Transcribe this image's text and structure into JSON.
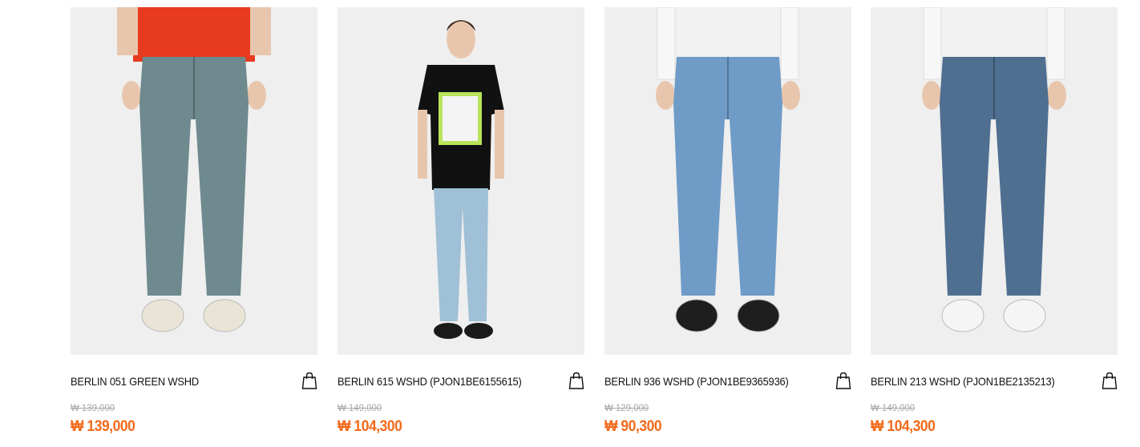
{
  "products": [
    {
      "name": "BERLIN 051 GREEN WSHD",
      "original_price": "₩ 139,000",
      "sale_price": "₩ 139,000",
      "top_color": "#e83a1e",
      "denim_color": "#6e8a8e",
      "shoe_color": "#e9e4d6",
      "crop": "close"
    },
    {
      "name": "BERLIN 615 WSHD (PJON1BE6155615)",
      "original_price": "₩ 149,000",
      "sale_price": "₩ 104,300",
      "top_color": "#111111",
      "denim_color": "#9fc0d6",
      "shoe_color": "#1a1a1a",
      "crop": "full"
    },
    {
      "name": "BERLIN 936 WSHD (PJON1BE9365936)",
      "original_price": "₩ 129,000",
      "sale_price": "₩ 90,300",
      "top_color": "#f2f2f2",
      "denim_color": "#6f9bc7",
      "shoe_color": "#1e1e1e",
      "crop": "close"
    },
    {
      "name": "BERLIN 213 WSHD (PJON1BE2135213)",
      "original_price": "₩ 149,000",
      "sale_price": "₩ 104,300",
      "top_color": "#f2f2f2",
      "denim_color": "#4f6f90",
      "shoe_color": "#f5f5f5",
      "crop": "close"
    }
  ],
  "theme": {
    "sale_color": "#f26a1b",
    "muted_color": "#a8a8a8",
    "photo_bg": "#efefef"
  },
  "icons": {
    "cart": "shopping-bag-icon"
  }
}
